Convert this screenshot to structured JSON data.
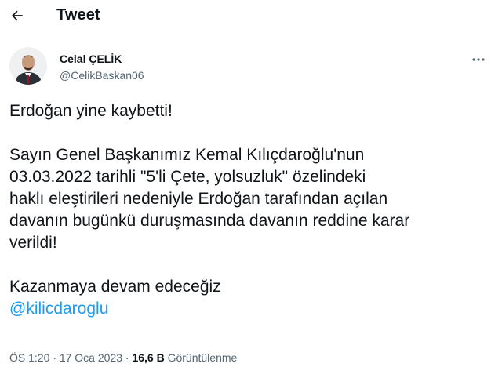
{
  "header": {
    "title": "Tweet",
    "back_icon": "arrow-left-icon"
  },
  "author": {
    "display_name": "Celal ÇELİK",
    "handle": "@CelikBaskan06"
  },
  "tweet": {
    "line1": "Erdoğan yine kaybetti!",
    "para2": [
      "Sayın Genel Başkanımız Kemal Kılıçdaroğlu'nun",
      "03.03.2022 tarihli \"5'li Çete, yolsuzluk\" özelindeki",
      "haklı eleştirileri nedeniyle Erdoğan tarafından açılan",
      "davanın bugünkü duruşmasında davanın reddine karar",
      "verildi!"
    ],
    "line3": "Kazanmaya devam edeceğiz",
    "mention": "@kilicdaroglu"
  },
  "meta": {
    "time": "ÖS 1:20",
    "date": "17 Oca 2023",
    "separator": "·",
    "views_count": "16,6 B",
    "views_label": "Görüntülenme"
  },
  "colors": {
    "accent": "#1d9bf0",
    "text": "#0f1419",
    "secondary": "#536471"
  }
}
